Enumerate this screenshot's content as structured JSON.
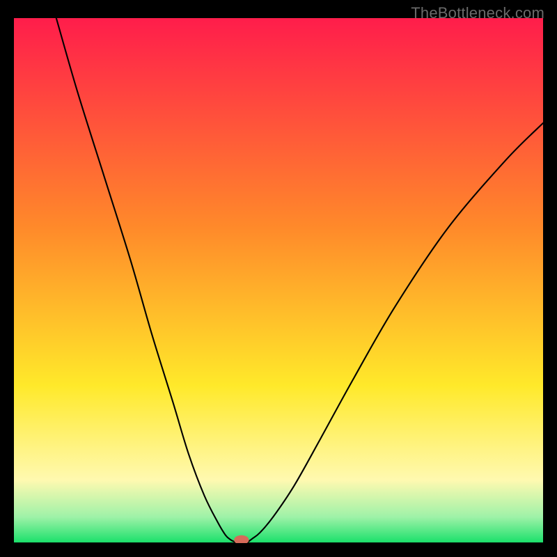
{
  "watermark": "TheBottleneck.com",
  "chart_data": {
    "type": "line",
    "title": "",
    "xlabel": "",
    "ylabel": "",
    "xlim": [
      0,
      100
    ],
    "ylim": [
      0,
      100
    ],
    "gradient_stops": [
      {
        "offset": 0,
        "color": "#ff1d4b"
      },
      {
        "offset": 40,
        "color": "#ff8a2a"
      },
      {
        "offset": 70,
        "color": "#ffe92a"
      },
      {
        "offset": 88,
        "color": "#fff9b0"
      },
      {
        "offset": 95,
        "color": "#9ff2a8"
      },
      {
        "offset": 100,
        "color": "#18e06a"
      }
    ],
    "series": [
      {
        "name": "left-branch",
        "x": [
          8,
          12,
          17,
          22,
          26,
          30,
          33,
          36,
          38.5,
          40,
          41,
          41.8
        ],
        "y": [
          100,
          86,
          70,
          54,
          40,
          27,
          17,
          9,
          4,
          1.5,
          0.6,
          0.2
        ]
      },
      {
        "name": "right-branch",
        "x": [
          44.2,
          45,
          46.5,
          49,
          53,
          58,
          64,
          72,
          82,
          93,
          100
        ],
        "y": [
          0.2,
          0.8,
          2,
          5,
          11,
          20,
          31,
          45,
          60,
          73,
          80
        ]
      },
      {
        "name": "baseline",
        "x": [
          0,
          100
        ],
        "y": [
          0,
          0
        ]
      }
    ],
    "marker": {
      "name": "notch-marker",
      "x": 43,
      "y": 0.6,
      "rx": 1.4,
      "ry": 0.9,
      "color": "#d66b5a"
    }
  }
}
